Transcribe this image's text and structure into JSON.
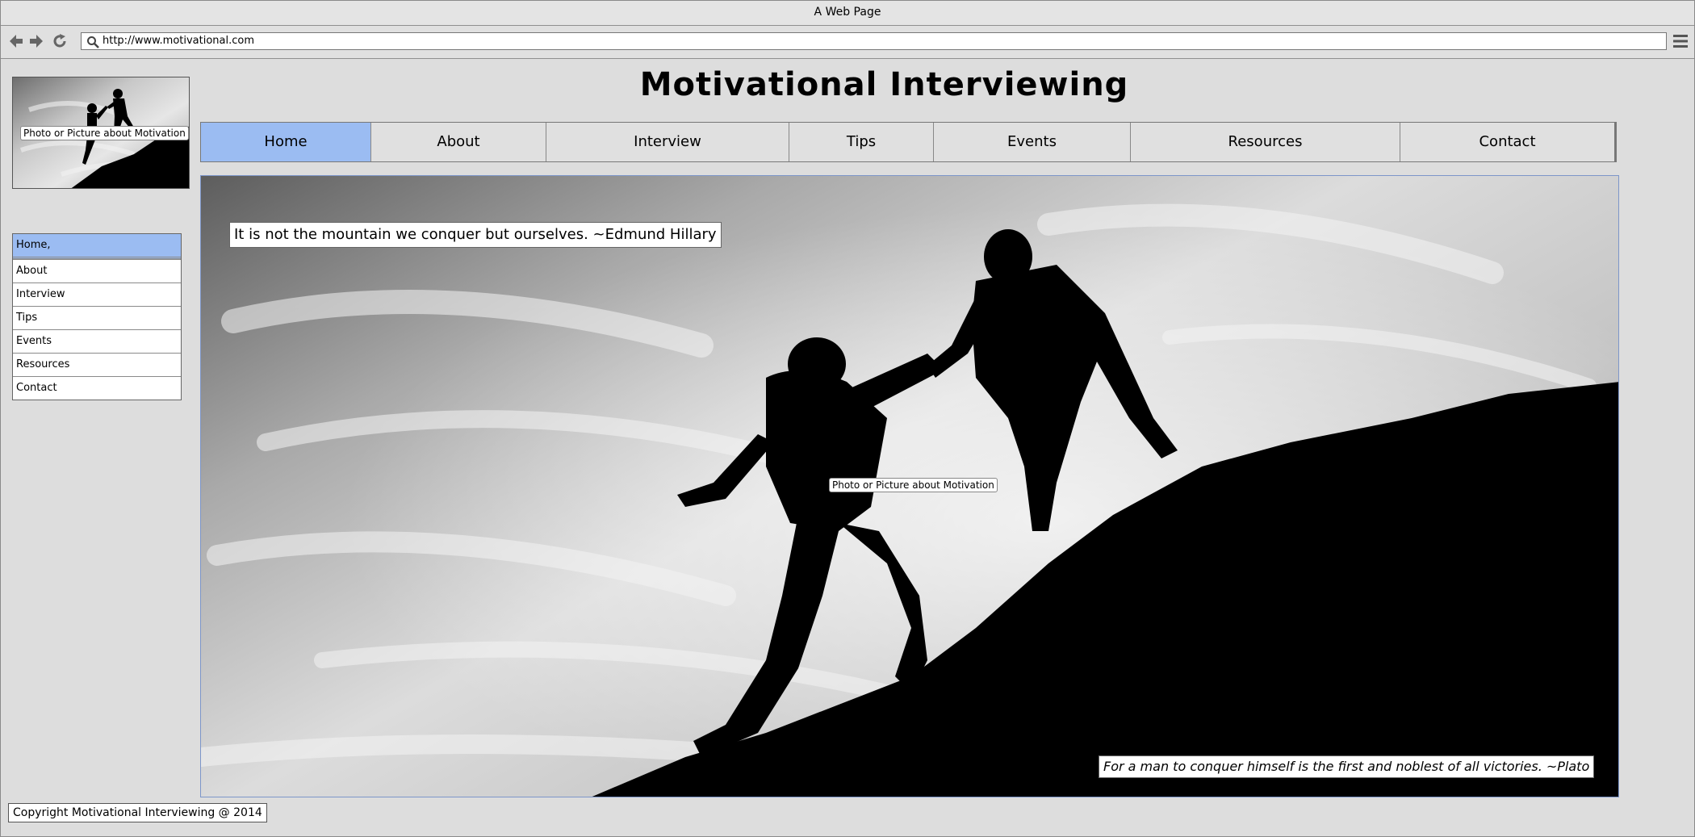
{
  "browser": {
    "window_title": "A Web Page",
    "url": "http://www.motivational.com",
    "icons": [
      "back-arrow-icon",
      "forward-arrow-icon",
      "reload-icon",
      "search-icon",
      "menu-icon"
    ]
  },
  "site": {
    "title": "Motivational Interviewing"
  },
  "top_nav": {
    "tabs": [
      {
        "label": "Home"
      },
      {
        "label": "About"
      },
      {
        "label": "Interview"
      },
      {
        "label": "Tips"
      },
      {
        "label": "Events"
      },
      {
        "label": "Resources"
      },
      {
        "label": "Contact"
      }
    ],
    "active_tab": "Home",
    "active_color": "#9bbcf2"
  },
  "sidebar": {
    "photo_label": "Photo or Picture about Motivation",
    "items": [
      {
        "label": "Home,"
      },
      {
        "label": "About"
      },
      {
        "label": "Interview"
      },
      {
        "label": "Tips"
      },
      {
        "label": "Events"
      },
      {
        "label": "Resources"
      },
      {
        "label": "Contact"
      }
    ]
  },
  "hero": {
    "photo_label": "Photo or Picture about Motivation",
    "quote_top": "It is not the mountain we conquer but ourselves. ~Edmund Hillary",
    "quote_bottom": "For a man to conquer himself is the first and noblest of all victories. ~Plato"
  },
  "footer": {
    "copyright": "Copyright Motivational Interviewing @ 2014"
  }
}
